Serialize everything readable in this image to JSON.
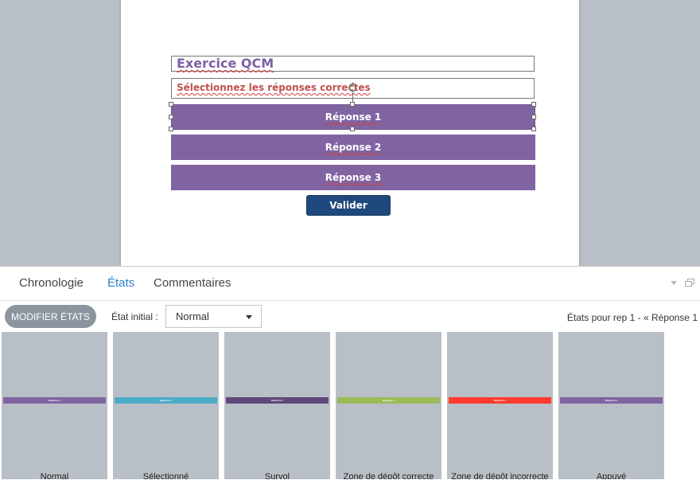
{
  "slide": {
    "title": "Exercice QCM",
    "subtitle": "Sélectionnez les réponses correctes",
    "answers": [
      "Réponse 1",
      "Réponse 2",
      "Réponse 3"
    ],
    "validate_label": "Valider",
    "colors": {
      "answer": "#8064a2",
      "validate": "#1f497d",
      "title": "#7d60a5",
      "subtitle": "#c0504d"
    }
  },
  "panel": {
    "tabs": [
      "Chronologie",
      "États",
      "Commentaires"
    ],
    "active_tab": "États",
    "modify_states_label": "MODIFIER ÉTATS",
    "initial_state_label": "État initial :",
    "initial_state_value": "Normal",
    "states_for_label": "États pour rep 1 - « Réponse 1",
    "icons": [
      "dropdown-arrow-icon",
      "restore-panel-icon"
    ]
  },
  "states": [
    {
      "name": "Normal",
      "bar_label": "Réponse 1",
      "color": "#8064a2"
    },
    {
      "name": "Sélectionné",
      "bar_label": "Réponse 1",
      "color": "#4bacc6"
    },
    {
      "name": "Survol",
      "bar_label": "Réponse 1",
      "color": "#5f497a"
    },
    {
      "name": "Zone de dépôt correcte",
      "bar_label": "Réponse 1",
      "color": "#9bbb59"
    },
    {
      "name": "Zone de dépôt incorrecte",
      "bar_label": "Réponse 1",
      "color": "#ff3b30"
    },
    {
      "name": "Appuyé",
      "bar_label": "Réponse 1",
      "color": "#8064a2"
    }
  ]
}
